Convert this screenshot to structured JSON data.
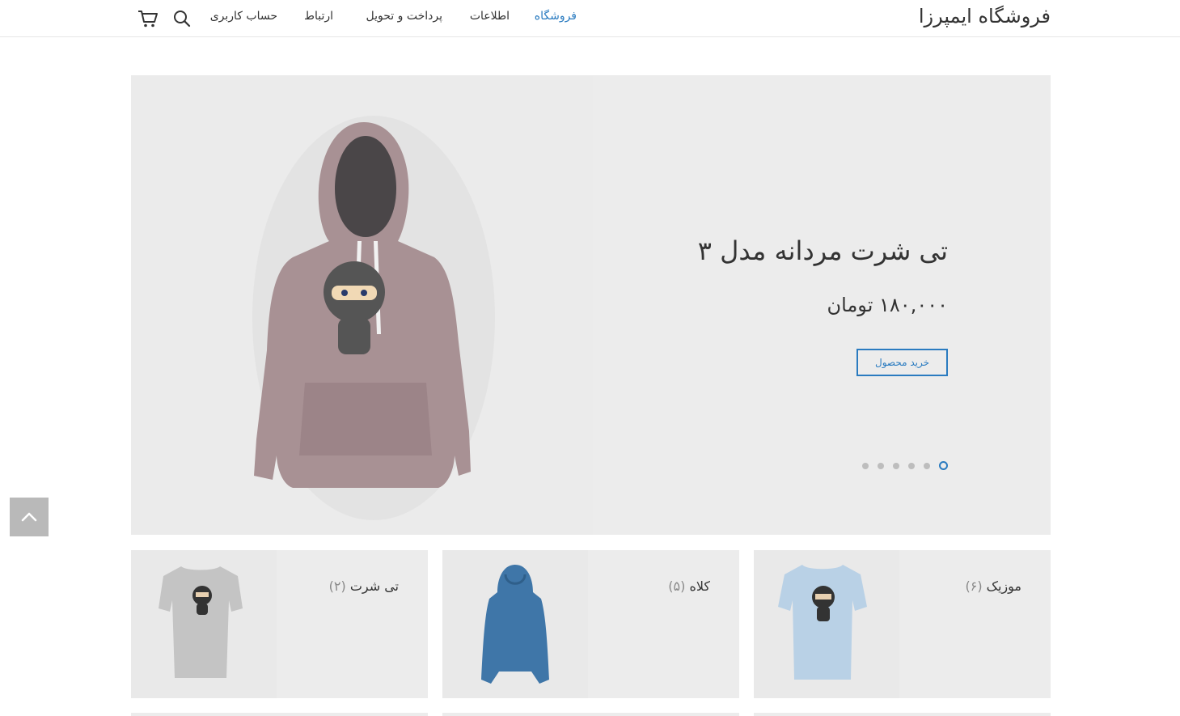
{
  "header": {
    "site_title": "فروشگاه ایمپرزا",
    "nav": [
      {
        "label": "فروشگاه",
        "active": true
      },
      {
        "label": "اطلاعات",
        "active": false
      },
      {
        "label": "پرداخت و تحویل",
        "active": false
      },
      {
        "label": "ارتباط",
        "active": false
      },
      {
        "label": "حساب کاربری",
        "active": false
      }
    ],
    "icons": [
      "search-icon",
      "cart-icon"
    ]
  },
  "hero": {
    "title": "تی شرت مردانه مدل ۳",
    "price": "۱۸۰,۰۰۰ تومان",
    "button_label": "خرید محصول",
    "slide_count": 6,
    "active_slide": 0
  },
  "categories": [
    {
      "name": "موزیک",
      "count": "(۶)"
    },
    {
      "name": "کلاه",
      "count": "(۵)"
    },
    {
      "name": "تی شرت",
      "count": "(۲)"
    }
  ],
  "colors": {
    "accent": "#2a7bc0",
    "text": "#333333",
    "panel": "#ececec",
    "back_to_top": "#b9b9b9"
  }
}
